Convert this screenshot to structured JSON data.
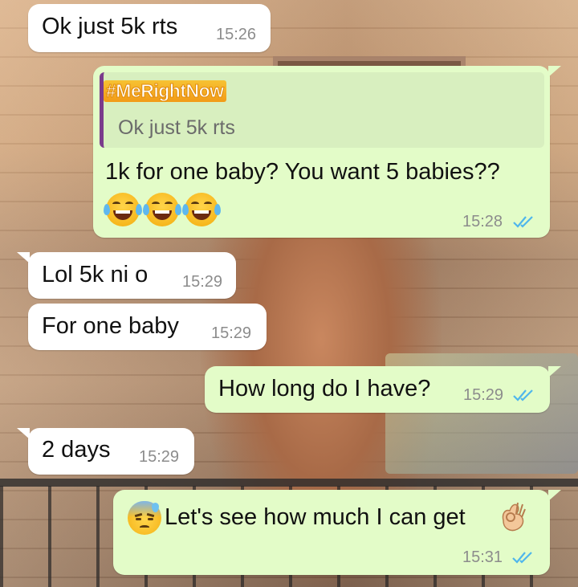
{
  "chat": {
    "messages": [
      {
        "direction": "incoming",
        "text": "Ok just 5k rts",
        "time": "15:26"
      },
      {
        "direction": "outgoing",
        "quote": {
          "author": "#MeRightNow",
          "text": "Ok just 5k rts"
        },
        "text": "1k for one baby? You want 5 babies??",
        "emoji": "😂😂😂",
        "time": "15:28",
        "status": "read"
      },
      {
        "direction": "incoming",
        "text": "Lol 5k ni o",
        "time": "15:29"
      },
      {
        "direction": "incoming",
        "text": "For one baby",
        "time": "15:29"
      },
      {
        "direction": "outgoing",
        "text": "How long do I have?",
        "time": "15:29",
        "status": "read"
      },
      {
        "direction": "incoming",
        "text": "2 days",
        "time": "15:29"
      },
      {
        "direction": "outgoing",
        "text": "Let's see how much I can get",
        "time": "15:31",
        "status": "read"
      }
    ]
  },
  "colors": {
    "incoming_bubble": "#ffffff",
    "outgoing_bubble": "#e3fcc8",
    "read_ticks": "#4fb6ec",
    "quote_bar": "#7a3b8c"
  },
  "icons": [
    "tears-of-joy-emoji",
    "anxious-sweat-emoji",
    "ok-hand-emoji",
    "double-check-icon"
  ]
}
